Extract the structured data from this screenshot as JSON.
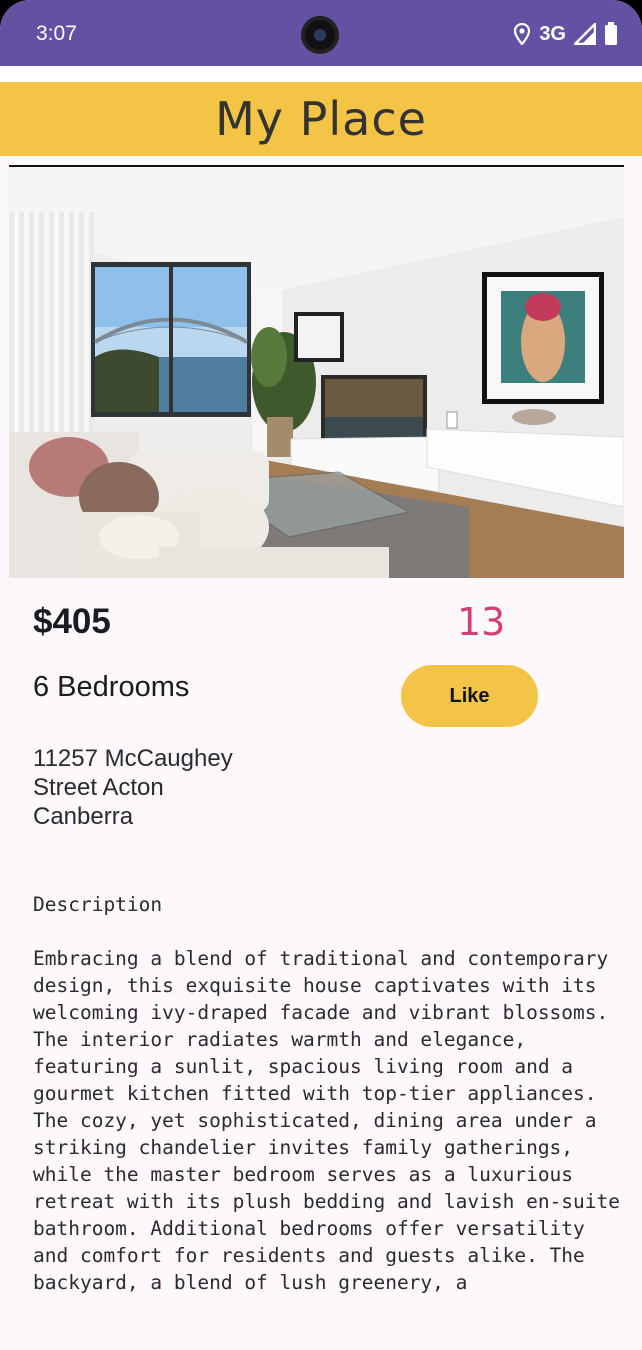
{
  "status_bar": {
    "time": "3:07",
    "network": "3G",
    "icons": [
      "location-icon",
      "signal-icon",
      "battery-icon"
    ]
  },
  "app": {
    "title": "My Place"
  },
  "listing": {
    "photo": "living-room-photo",
    "price": "$405",
    "likes": "13",
    "bedrooms": "6 Bedrooms",
    "like_label": "Like",
    "address": "11257 McCaughey\nStreet Acton\nCanberra",
    "description_heading": "Description",
    "description": "Embracing a blend of traditional and contemporary design, this exquisite house captivates with its welcoming ivy-draped facade and vibrant blossoms. The interior radiates warmth and elegance, featuring a sunlit, spacious living room and a gourmet kitchen fitted with top-tier appliances.\nThe cozy, yet sophisticated, dining area under a striking chandelier invites family gatherings, while the master bedroom serves as a luxurious retreat with its plush bedding and lavish en-suite bathroom. Additional bedrooms offer versatility and comfort for residents and guests alike. The backyard, a blend of lush greenery, a"
  },
  "colors": {
    "status_bar": "#6351a4",
    "header": "#f3c445",
    "likes_text": "#d43f73",
    "background": "#fcf8fc"
  }
}
